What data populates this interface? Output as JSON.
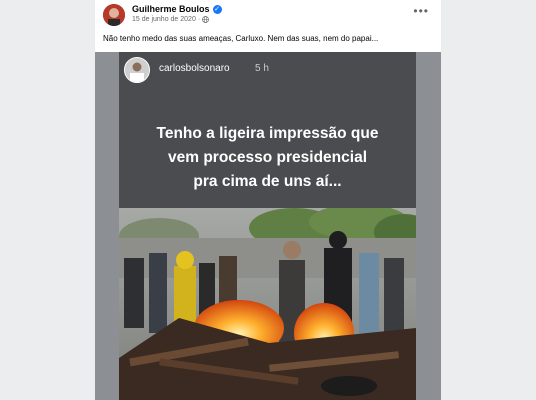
{
  "post": {
    "author": "Guilherme Boulos",
    "verified_icon": "verified-badge-icon",
    "date": "15 de junho de 2020",
    "separator": "·",
    "audience_icon": "globe-icon",
    "more_icon": "more-options-icon",
    "text": "Não tenho medo das suas ameaças, Carluxo. Nem das suas, nem do papai..."
  },
  "story": {
    "username": "carlosbolsonaro",
    "time": "5 h",
    "caption_lines": [
      "Tenho a ligeira impressão que",
      "vem processo presidencial",
      "pra cima de uns aí..."
    ]
  },
  "colors": {
    "facebook_blue": "#1877f2",
    "story_background": "#4a4c4f",
    "meta_text": "#65676b"
  }
}
